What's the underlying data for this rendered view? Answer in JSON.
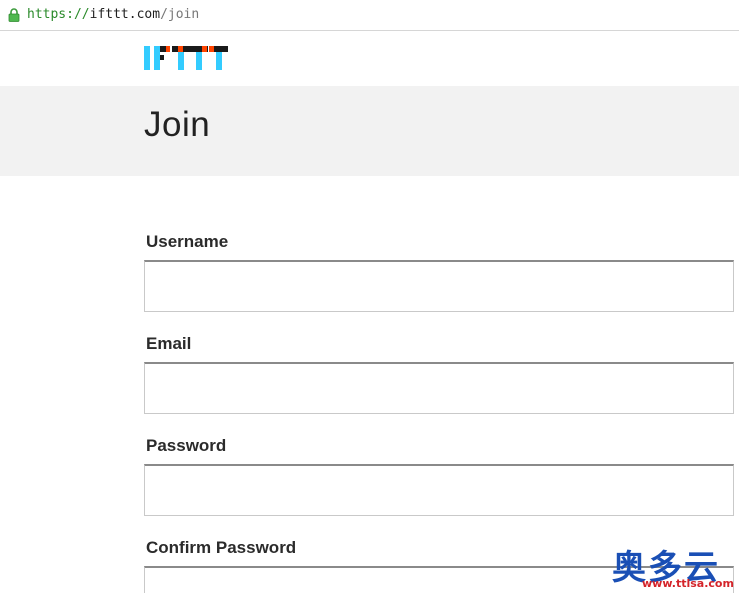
{
  "browser": {
    "url_scheme": "https://",
    "url_host": "ifttt.com",
    "url_path": "/join"
  },
  "brand": {
    "logo_text": "IFTTT",
    "logo_colors": [
      "#33ccff",
      "#1a1a1a",
      "#ff4400",
      "#33ccff"
    ]
  },
  "header": {
    "title": "Join"
  },
  "form": {
    "fields": [
      {
        "label": "Username",
        "value": ""
      },
      {
        "label": "Email",
        "value": ""
      },
      {
        "label": "Password",
        "value": ""
      },
      {
        "label": "Confirm Password",
        "value": ""
      }
    ]
  },
  "watermark": {
    "title": "奥多云",
    "url": "www.ttlsa.com"
  },
  "icons": {
    "lock": "lock-icon"
  }
}
